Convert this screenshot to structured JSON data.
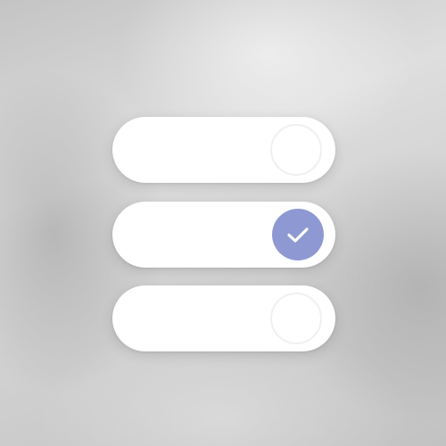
{
  "toggles": [
    {
      "checked": false,
      "label": ""
    },
    {
      "checked": true,
      "label": ""
    },
    {
      "checked": false,
      "label": ""
    }
  ],
  "colors": {
    "track": "#ffffff",
    "knob_off": "#ffffff",
    "knob_on": "#8e98d3",
    "check": "#ffffff",
    "background": "#d0d0d0"
  },
  "icons": {
    "checked_indicator": "check-icon"
  }
}
